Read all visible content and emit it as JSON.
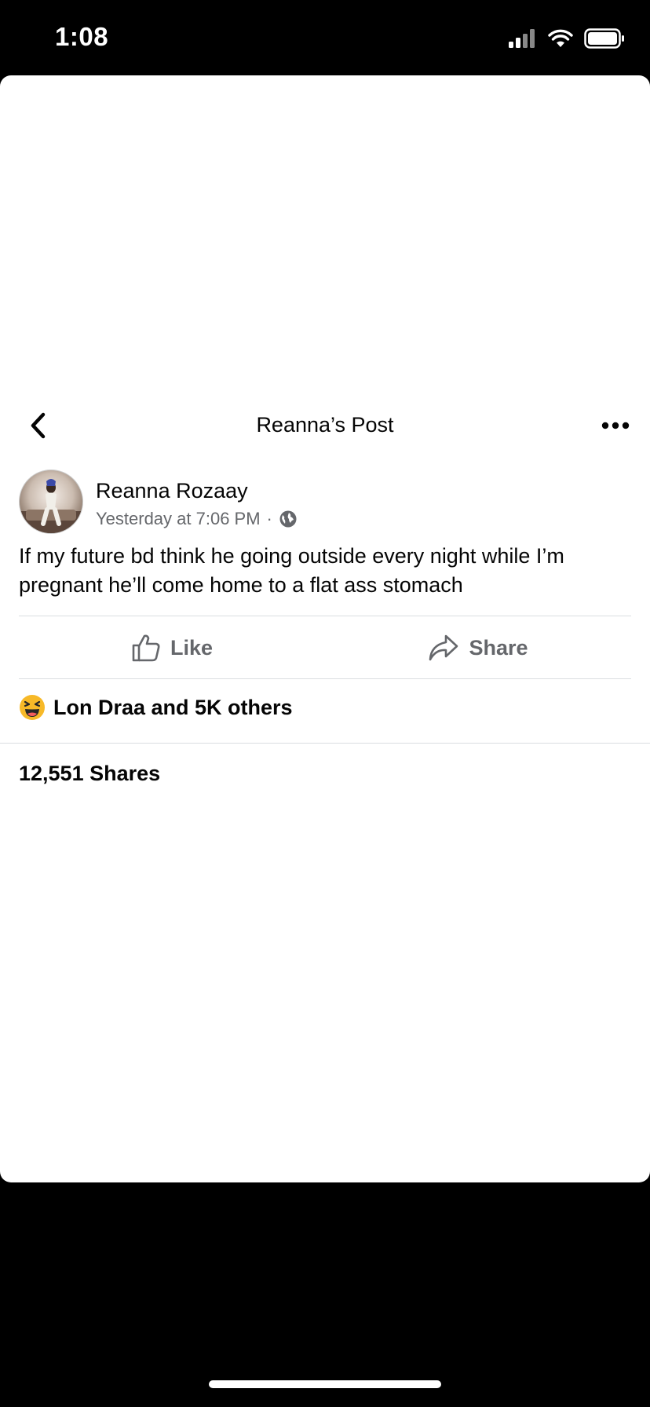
{
  "status_bar": {
    "time": "1:08"
  },
  "navbar": {
    "title": "Reanna’s Post"
  },
  "post": {
    "author": "Reanna Rozaay",
    "timestamp": "Yesterday at 7:06 PM",
    "meta_separator": "·",
    "text": "If my future bd think he going outside every night while I’m pregnant he’ll come home to a flat ass stomach",
    "actions": {
      "like_label": "Like",
      "share_label": "Share"
    },
    "reactions_text": "Lon Draa and 5K others",
    "shares_text": "12,551 Shares"
  },
  "colors": {
    "secondary_text": "#65676b",
    "divider": "#dadde1",
    "haha_emoji": "#f7b928"
  },
  "icons": {
    "back": "chevron-left-icon",
    "more": "more-dots-icon",
    "privacy": "globe-icon",
    "like": "thumbs-up-icon",
    "share": "share-arrow-icon",
    "reaction": "haha-emoji-icon"
  }
}
